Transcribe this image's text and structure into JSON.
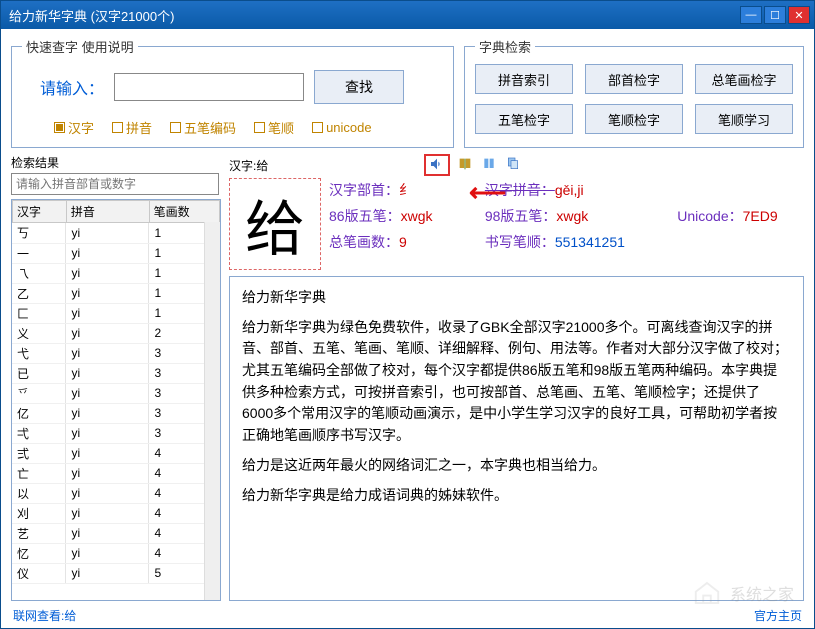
{
  "window": {
    "title": "给力新华字典    (汉字21000个)"
  },
  "search": {
    "legend": "快速查字      使用说明",
    "label": "请输入：",
    "find": "查找",
    "options": [
      "汉字",
      "拼音",
      "五笔编码",
      "笔顺",
      "unicode"
    ],
    "selected": 0
  },
  "index": {
    "legend": "字典检索",
    "buttons": [
      "拼音索引",
      "部首检字",
      "总笔画检字",
      "五笔检字",
      "笔顺检字",
      "笔顺学习"
    ]
  },
  "results": {
    "label": "检索结果",
    "placeholder": "请输入拼音部首或数字",
    "columns": [
      "汉字",
      "拼音",
      "笔画数"
    ],
    "rows": [
      [
        "丂",
        "yi",
        "1"
      ],
      [
        "一",
        "yi",
        "1"
      ],
      [
        "乁",
        "yi",
        "1"
      ],
      [
        "乙",
        "yi",
        "1"
      ],
      [
        "匚",
        "yi",
        "1"
      ],
      [
        "义",
        "yi",
        "2"
      ],
      [
        "弋",
        "yi",
        "3"
      ],
      [
        "已",
        "yi",
        "3"
      ],
      [
        "乊",
        "yi",
        "3"
      ],
      [
        "亿",
        "yi",
        "3"
      ],
      [
        "弌",
        "yi",
        "3"
      ],
      [
        "弍",
        "yi",
        "4"
      ],
      [
        "亡",
        "yi",
        "4"
      ],
      [
        "以",
        "yi",
        "4"
      ],
      [
        "刈",
        "yi",
        "4"
      ],
      [
        "艺",
        "yi",
        "4"
      ],
      [
        "忆",
        "yi",
        "4"
      ],
      [
        "仪",
        "yi",
        "5"
      ]
    ]
  },
  "char": {
    "header_label": "汉字:给",
    "glyph": "给",
    "radical_k": "汉字部首：",
    "radical_v": "纟",
    "pinyin_k_strike": "汉字拼音：",
    "pinyin_v": "gěi,ji",
    "wubi86_k": "86版五笔：",
    "wubi86_v": "xwgk",
    "wubi98_k": "98版五笔：",
    "wubi98_v": "xwgk",
    "uni_k": "Unicode：",
    "uni_v": "7ED9",
    "strokes_k": "总笔画数：",
    "strokes_v": "9",
    "order_k": "书写笔顺：",
    "order_v": "551341251"
  },
  "body": {
    "p1": "给力新华字典",
    "p2": "给力新华字典为绿色免费软件，收录了GBK全部汉字21000多个。可离线查询汉字的拼音、部首、五笔、笔画、笔顺、详细解释、例句、用法等。作者对大部分汉字做了校对；尤其五笔编码全部做了校对，每个汉字都提供86版五笔和98版五笔两种编码。本字典提供多种检索方式，可按拼音索引，也可按部首、总笔画、五笔、笔顺检字；还提供了6000多个常用汉字的笔顺动画演示，是中小学生学习汉字的良好工具，可帮助初学者按正确地笔画顺序书写汉字。",
    "p3": "给力是这近两年最火的网络词汇之一，本字典也相当给力。",
    "p4": "给力新华字典是给力成语词典的姊妹软件。"
  },
  "footer": {
    "left": "联网查看:给",
    "right": "官方主页"
  },
  "watermark": "系统之家"
}
